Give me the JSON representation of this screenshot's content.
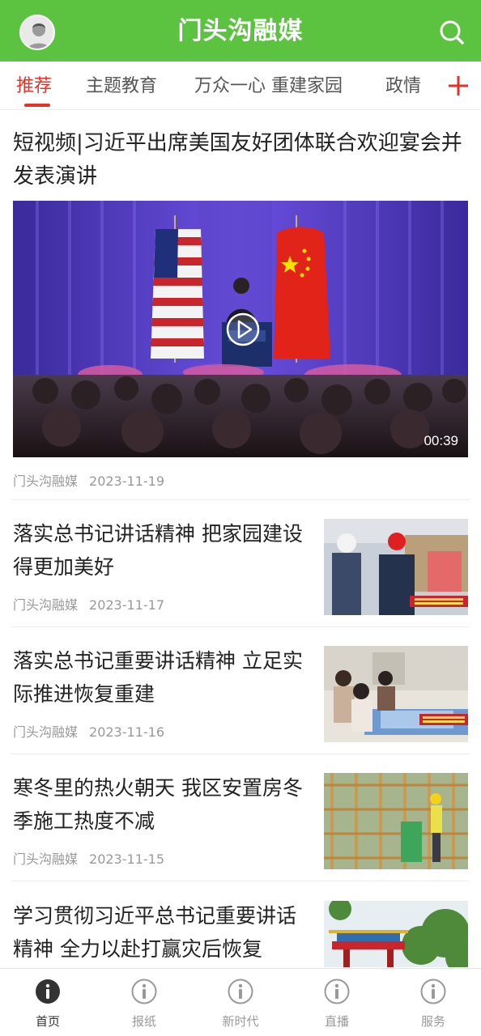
{
  "header": {
    "title": "门头沟融媒",
    "avatar_icon": "user-avatar-icon",
    "search_icon": "search-icon",
    "bg_color": "#5cc341"
  },
  "tabs": [
    {
      "label": "推荐",
      "active": true
    },
    {
      "label": "主题教育",
      "active": false
    },
    {
      "label": "万众一心 重建家园",
      "active": false
    },
    {
      "label": "政情",
      "active": false
    }
  ],
  "tab_add_icon": "plus-icon",
  "accent_color": "#e53227",
  "feature": {
    "title": "短视频|习近平出席美国友好团体联合欢迎宴会并发表演讲",
    "duration": "00:39",
    "source": "门头沟融媒",
    "date": "2023-11-19",
    "play_icon": "play-icon"
  },
  "articles": [
    {
      "title": "落实总书记讲话精神 把家园建设得更加美好",
      "source": "门头沟融媒",
      "date": "2023-11-17"
    },
    {
      "title": "落实总书记重要讲话精神 立足实际推进恢复重建",
      "source": "门头沟融媒",
      "date": "2023-11-16"
    },
    {
      "title": "寒冬里的热火朝天 我区安置房冬季施工热度不减",
      "source": "门头沟融媒",
      "date": "2023-11-15"
    },
    {
      "title": "学习贯彻习近平总书记重要讲话精神 全力以赴打赢灾后恢复",
      "source": "",
      "date": ""
    }
  ],
  "bottom_nav": [
    {
      "label": "首页",
      "icon": "info-icon",
      "active": true
    },
    {
      "label": "报纸",
      "icon": "info-icon",
      "active": false
    },
    {
      "label": "新时代",
      "icon": "info-icon",
      "active": false
    },
    {
      "label": "直播",
      "icon": "info-icon",
      "active": false
    },
    {
      "label": "服务",
      "icon": "info-icon",
      "active": false
    }
  ]
}
